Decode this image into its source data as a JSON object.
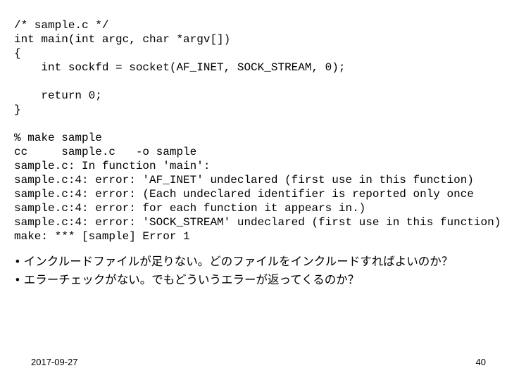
{
  "code": {
    "line1": "/* sample.c */",
    "line2": "int main(int argc, char *argv[])",
    "line3": "{",
    "line4": "    int sockfd = socket(AF_INET, SOCK_STREAM, 0);",
    "line5": "",
    "line6": "    return 0;",
    "line7": "}",
    "line8": "",
    "line9": "% make sample",
    "line10": "cc     sample.c   -o sample",
    "line11": "sample.c: In function 'main':",
    "line12": "sample.c:4: error: 'AF_INET' undeclared (first use in this function)",
    "line13": "sample.c:4: error: (Each undeclared identifier is reported only once",
    "line14": "sample.c:4: error: for each function it appears in.)",
    "line15": "sample.c:4: error: 'SOCK_STREAM' undeclared (first use in this function)",
    "line16": "make: *** [sample] Error 1"
  },
  "bullets": {
    "b1": "インクルードファイルが足りない。どのファイルをインクルードすればよいのか？",
    "b2": "エラーチェックがない。でもどういうエラーが返ってくるのか？"
  },
  "footer": {
    "date": "2017-09-27",
    "page": "40"
  }
}
